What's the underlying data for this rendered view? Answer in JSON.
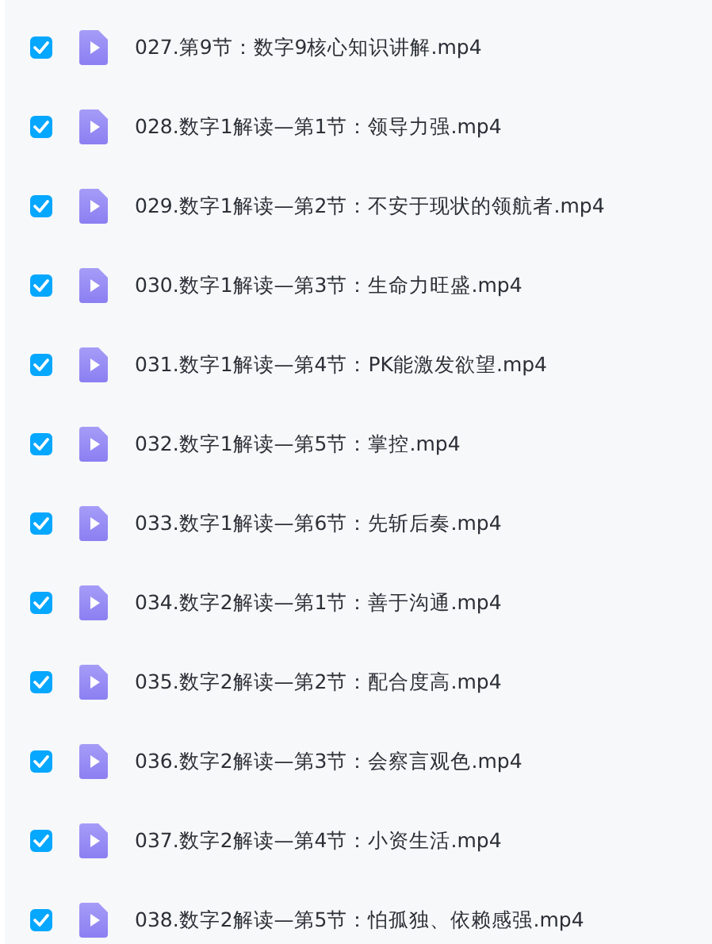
{
  "files": [
    {
      "name": "027.第9节：数字9核心知识讲解.mp4",
      "checked": true
    },
    {
      "name": "028.数字1解读—第1节：领导力强.mp4",
      "checked": true
    },
    {
      "name": "029.数字1解读—第2节：不安于现状的领航者.mp4",
      "checked": true
    },
    {
      "name": "030.数字1解读—第3节：生命力旺盛.mp4",
      "checked": true
    },
    {
      "name": "031.数字1解读—第4节：PK能激发欲望.mp4",
      "checked": true
    },
    {
      "name": "032.数字1解读—第5节：掌控.mp4",
      "checked": true
    },
    {
      "name": "033.数字1解读—第6节：先斩后奏.mp4",
      "checked": true
    },
    {
      "name": "034.数字2解读—第1节：善于沟通.mp4",
      "checked": true
    },
    {
      "name": "035.数字2解读—第2节：配合度高.mp4",
      "checked": true
    },
    {
      "name": "036.数字2解读—第3节：会察言观色.mp4",
      "checked": true
    },
    {
      "name": "037.数字2解读—第4节：小资生活.mp4",
      "checked": true
    },
    {
      "name": "038.数字2解读—第5节：怕孤独、依赖感强.mp4",
      "checked": true
    }
  ]
}
